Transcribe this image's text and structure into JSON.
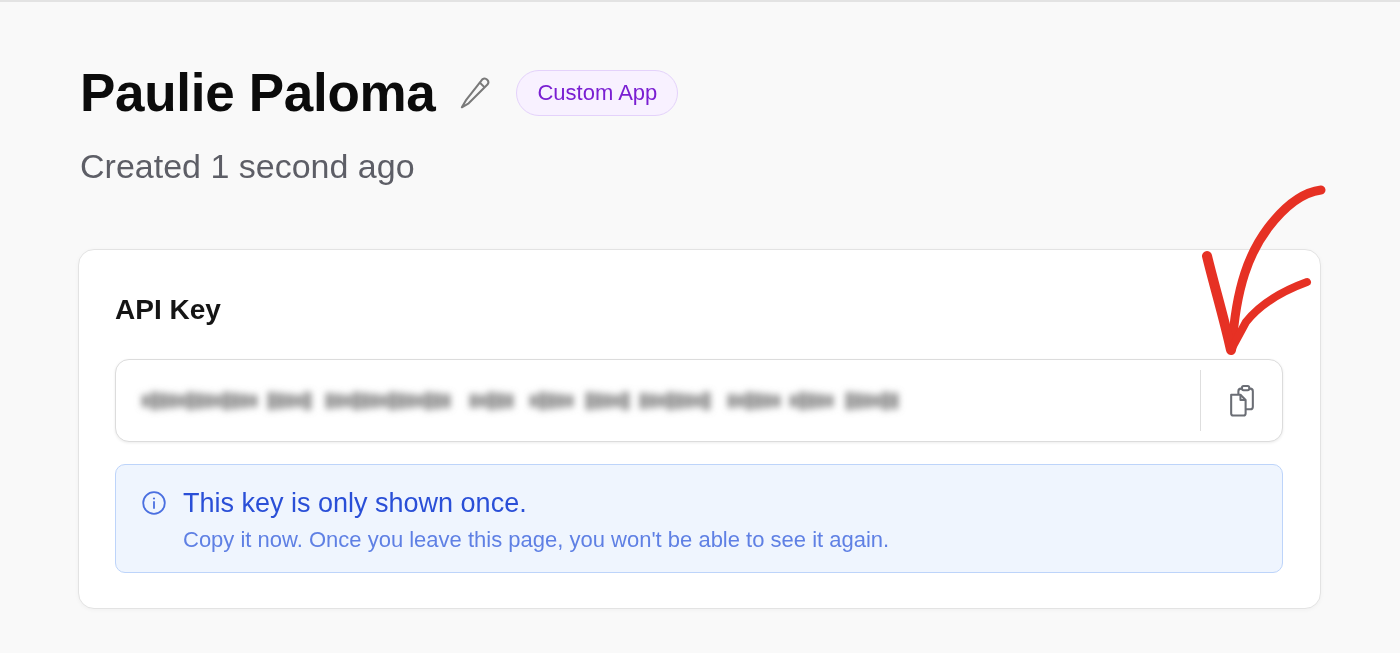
{
  "header": {
    "title": "Paulie Paloma",
    "badge": "Custom App",
    "subtitle": "Created 1 second ago"
  },
  "api_key_card": {
    "label": "API Key",
    "key_field": {
      "blurred": true
    },
    "alert": {
      "title": "This key is only shown once.",
      "message": "Copy it now. Once you leave this page, you won't be able to see it again."
    }
  },
  "annotation": {
    "kind": "arrow"
  }
}
